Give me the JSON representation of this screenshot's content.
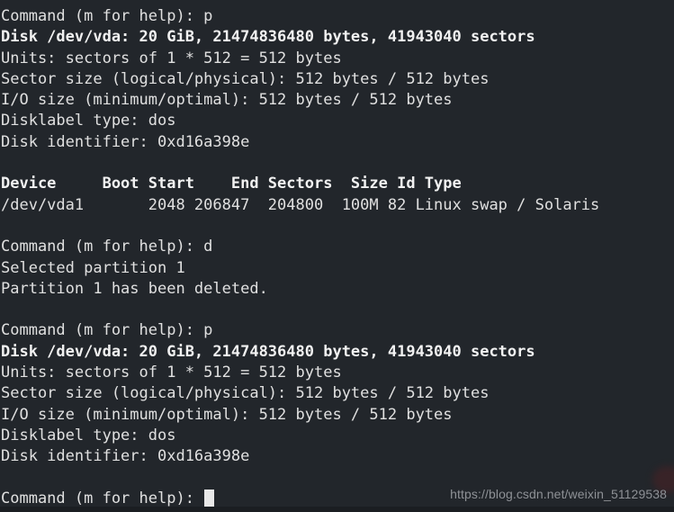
{
  "terminal": {
    "title": "fdisk session",
    "background_color": "#22262b",
    "text_color": "#e0e0e0",
    "cursor_color": "#e8e8e8",
    "font_size_px": 17,
    "columns": 68,
    "lines": [
      {
        "text": "Command (m for help): p",
        "bold": false
      },
      {
        "text": "Disk /dev/vda: 20 GiB, 21474836480 bytes, 41943040 sectors",
        "bold": true
      },
      {
        "text": "Units: sectors of 1 * 512 = 512 bytes",
        "bold": false
      },
      {
        "text": "Sector size (logical/physical): 512 bytes / 512 bytes",
        "bold": false
      },
      {
        "text": "I/O size (minimum/optimal): 512 bytes / 512 bytes",
        "bold": false
      },
      {
        "text": "Disklabel type: dos",
        "bold": false
      },
      {
        "text": "Disk identifier: 0xd16a398e",
        "bold": false
      },
      {
        "text": "",
        "bold": false
      },
      {
        "text": "Device     Boot Start    End Sectors  Size Id Type",
        "bold": true
      },
      {
        "text": "/dev/vda1       2048 206847  204800  100M 82 Linux swap / Solaris",
        "bold": false
      },
      {
        "text": "",
        "bold": false
      },
      {
        "text": "Command (m for help): d",
        "bold": false
      },
      {
        "text": "Selected partition 1",
        "bold": false
      },
      {
        "text": "Partition 1 has been deleted.",
        "bold": false
      },
      {
        "text": "",
        "bold": false
      },
      {
        "text": "Command (m for help): p",
        "bold": false
      },
      {
        "text": "Disk /dev/vda: 20 GiB, 21474836480 bytes, 41943040 sectors",
        "bold": true
      },
      {
        "text": "Units: sectors of 1 * 512 = 512 bytes",
        "bold": false
      },
      {
        "text": "Sector size (logical/physical): 512 bytes / 512 bytes",
        "bold": false
      },
      {
        "text": "I/O size (minimum/optimal): 512 bytes / 512 bytes",
        "bold": false
      },
      {
        "text": "Disklabel type: dos",
        "bold": false
      },
      {
        "text": "Disk identifier: 0xd16a398e",
        "bold": false
      },
      {
        "text": "",
        "bold": false
      },
      {
        "text": "Command (m for help): ",
        "bold": false,
        "cursor": true
      }
    ]
  },
  "disk": {
    "device": "/dev/vda",
    "size_human": "20 GiB",
    "size_bytes": "21474836480",
    "sectors_total": "41943040",
    "units": "sectors of 1 * 512 = 512 bytes",
    "sector_size_logical": "512 bytes",
    "sector_size_physical": "512 bytes",
    "io_size_minimum": "512 bytes",
    "io_size_optimal": "512 bytes",
    "disklabel_type": "dos",
    "disk_identifier": "0xd16a398e"
  },
  "partition_table": {
    "headers": [
      "Device",
      "Boot",
      "Start",
      "End",
      "Sectors",
      "Size",
      "Id",
      "Type"
    ],
    "rows": [
      {
        "device": "/dev/vda1",
        "boot": "",
        "start": "2048",
        "end": "206847",
        "sectors": "204800",
        "size": "100M",
        "id": "82",
        "type": "Linux swap / Solaris"
      }
    ]
  },
  "commands": {
    "prompt": "Command (m for help): ",
    "entered": [
      "p",
      "d",
      "p",
      ""
    ],
    "messages": [
      "Selected partition 1",
      "Partition 1 has been deleted."
    ]
  },
  "watermark": {
    "text": "https://blog.csdn.net/weixin_51129538",
    "color": "#8e9196"
  }
}
